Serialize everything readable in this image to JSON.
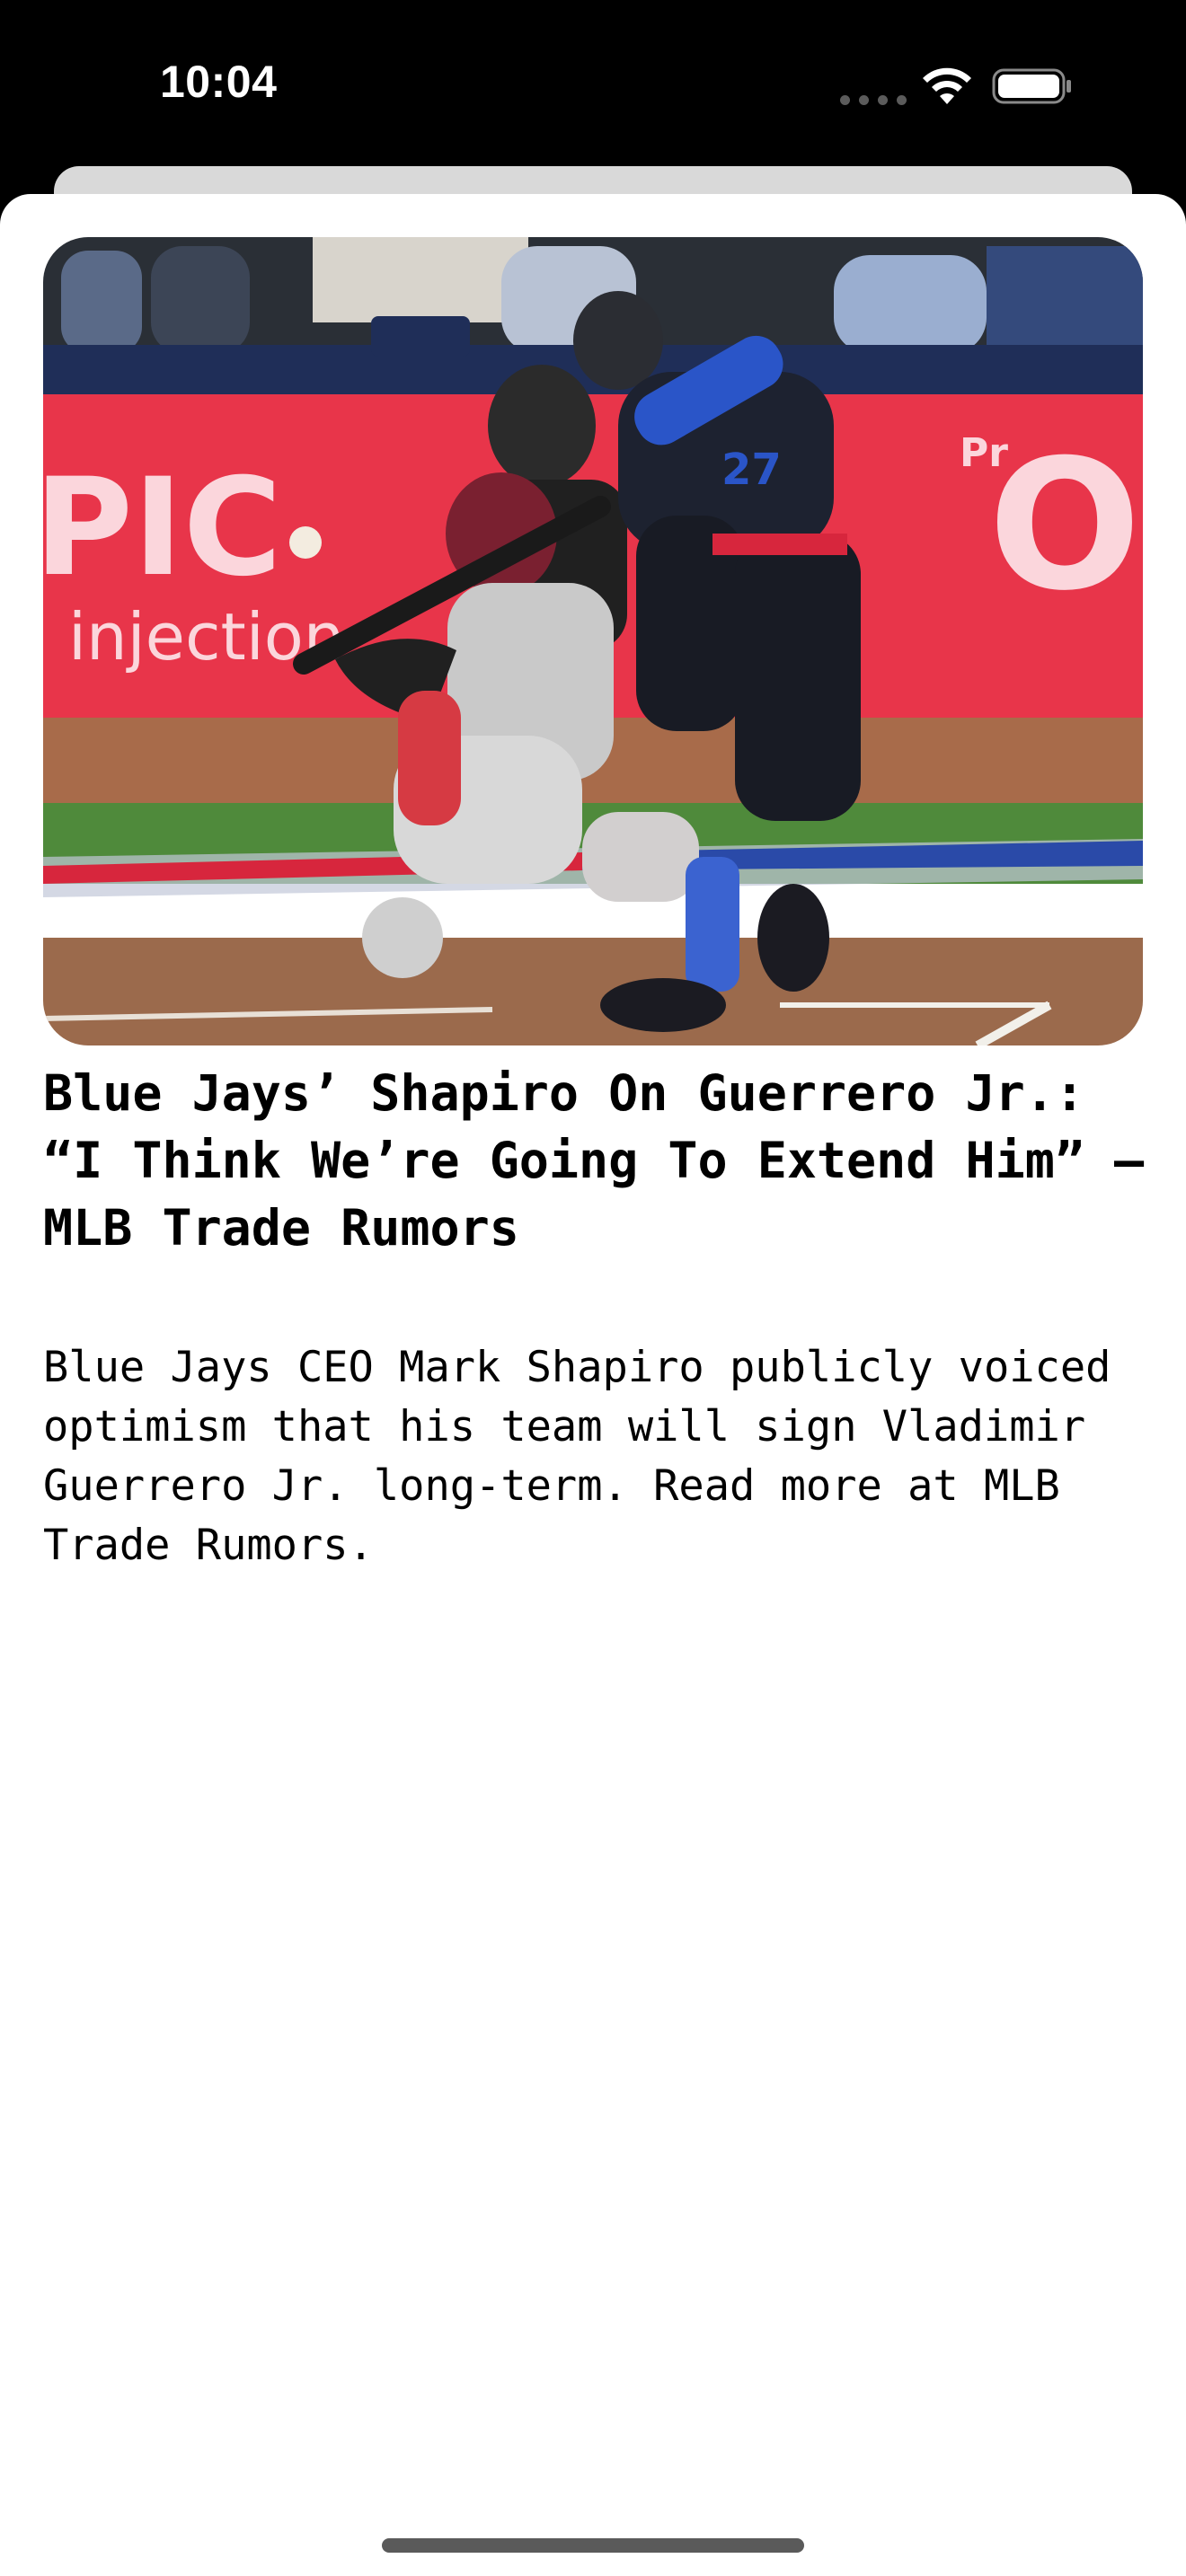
{
  "status_bar": {
    "time": "10:04",
    "icons": [
      "cellular-signal-icon",
      "wifi-icon",
      "battery-icon"
    ]
  },
  "article": {
    "image": {
      "alt": "Baseball batter swinging at home plate with catcher and umpire behind",
      "banner_text_left": "PIC",
      "banner_text_left_sub": "injection",
      "banner_text_right": "O",
      "banner_text_right_small": "Pr",
      "jersey_number": "27"
    },
    "headline": "Blue Jays’ Shapiro On Guerrero Jr.: “I Think We’re Going To Extend Him” – MLB Trade Rumors",
    "summary": "Blue Jays CEO Mark Shapiro publicly voiced optimism that his team will sign Vladimir Guerrero Jr. long-term. Read more at MLB Trade Rumors."
  },
  "colors": {
    "background": "#000000",
    "sheet": "#ffffff",
    "text": "#000000",
    "banner_red": "#e8354a"
  }
}
